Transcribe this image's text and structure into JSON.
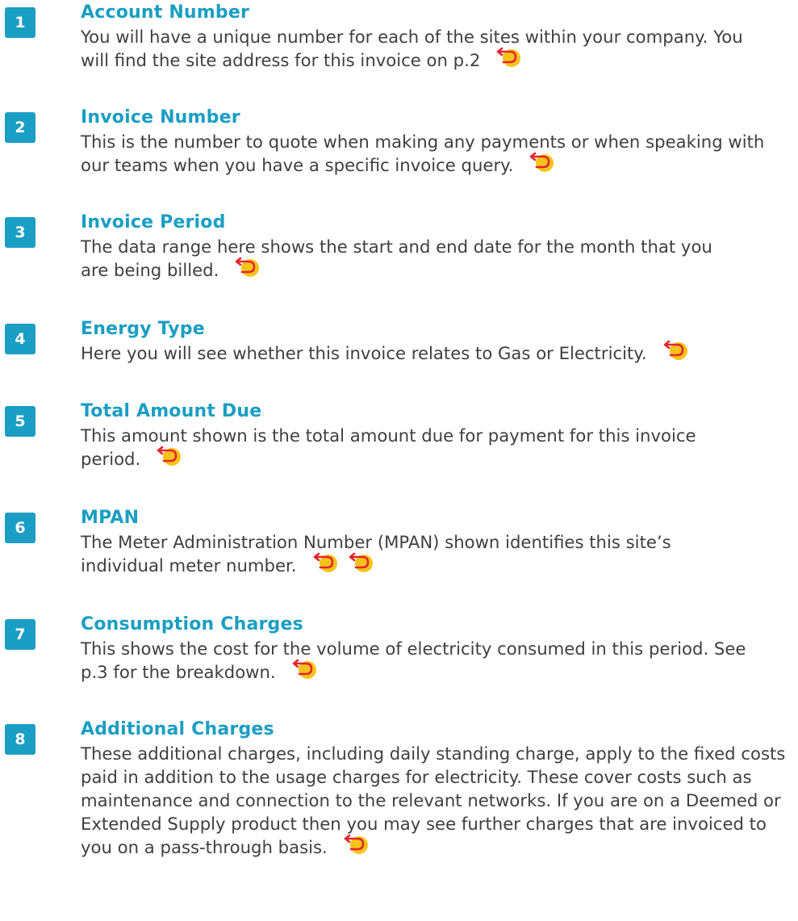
{
  "items": [
    {
      "number": "1",
      "title": "Account Number",
      "description": "You will have a unique number for each of the sites within your company. You will find the site address for this invoice on p.2"
    },
    {
      "number": "2",
      "title": "Invoice Number",
      "description": "This is the number to quote when making any payments or when speaking with our teams when you have a specific invoice query."
    },
    {
      "number": "3",
      "title": "Invoice Period",
      "description": "The data range here shows the start and end date for the month that you are being billed."
    },
    {
      "number": "4",
      "title": "Energy Type",
      "description": "Here you will see whether this invoice relates to Gas or Electricity."
    },
    {
      "number": "5",
      "title": "Total Amount Due",
      "description": "This amount shown is the total amount due for payment for this invoice period."
    },
    {
      "number": "6",
      "title": "MPAN",
      "description": "The Meter Administration Number (MPAN) shown identifies this site’s individual meter number."
    },
    {
      "number": "7",
      "title": "Consumption Charges",
      "description": "This shows the cost for the volume of electricity consumed in this period. See p.3 for the breakdown."
    },
    {
      "number": "8",
      "title": "Additional Charges",
      "description": "These additional charges, including daily standing charge, apply to the fixed costs paid in addition to the usage charges for electricity. These cover costs such as maintenance and connection to the relevant networks. If you are on a Deemed or Extended Supply product then you may see further charges that are invoiced to you on a pass-through basis."
    }
  ],
  "icon": {
    "name": "back-arrow-icon",
    "arrow_color": "#e3262b",
    "dot_color": "#f6c31a"
  }
}
